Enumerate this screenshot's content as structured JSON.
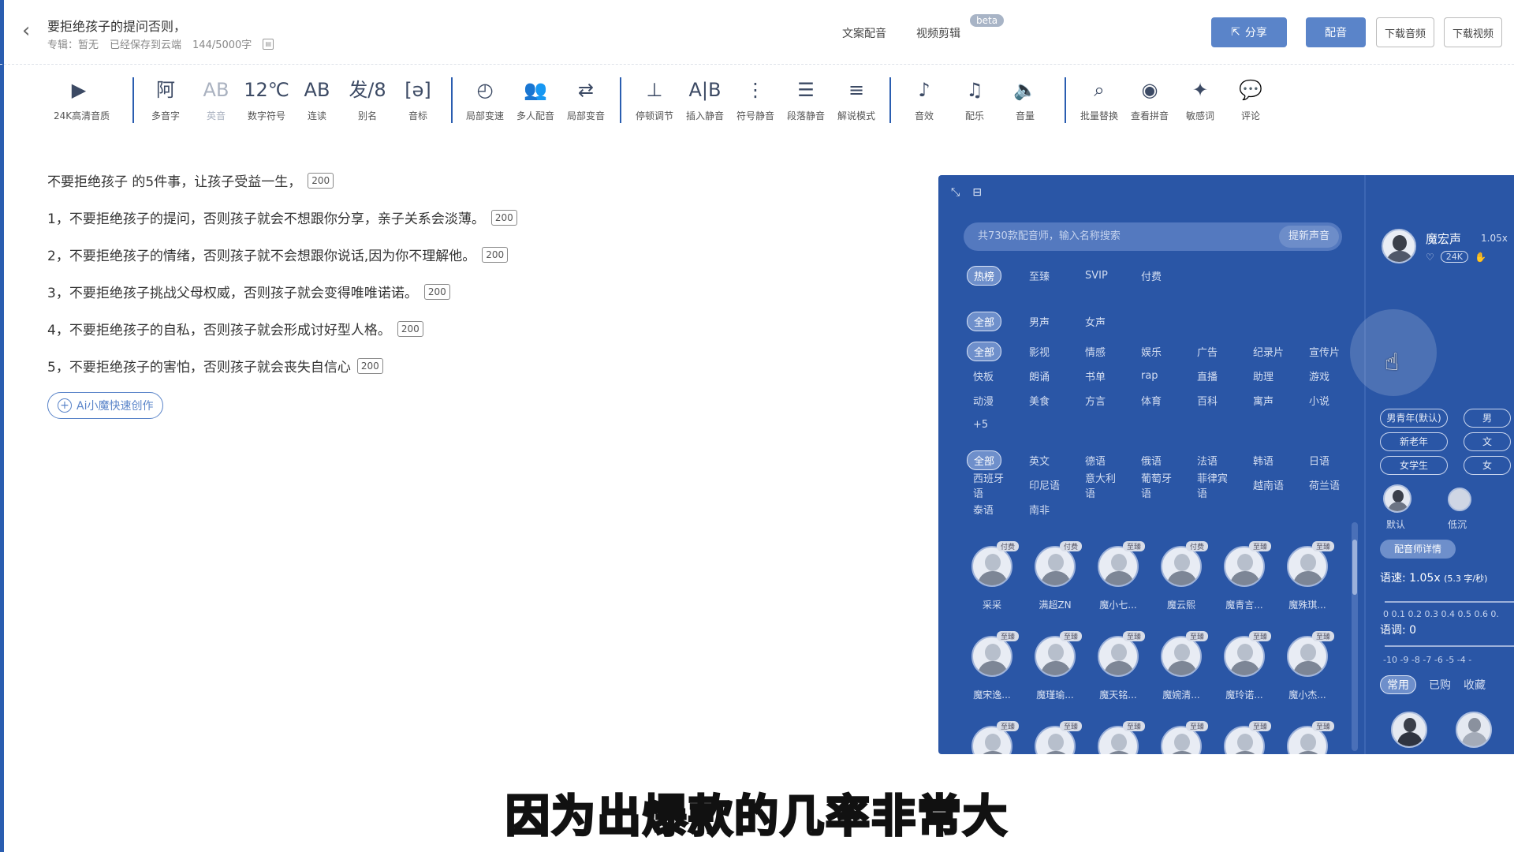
{
  "header": {
    "title": "要拒绝孩子的提问否则，",
    "album": "专辑：暂无",
    "save_status": "已经保存到云端",
    "word_count": "144/5000字",
    "links": [
      "文案配音",
      "视频剪辑"
    ],
    "beta_label": "beta",
    "share_label": "分享",
    "dub_label": "配音",
    "download_audio_label": "下载音频",
    "download_video_label": "下载视频"
  },
  "toolbar": {
    "items": [
      {
        "icon": "play-icon",
        "glyph": "▶",
        "label": "24K高清音质"
      },
      {
        "icon": "polyphone-icon",
        "glyph": "阿",
        "label": "多音字"
      },
      {
        "icon": "english-icon",
        "glyph": "AB",
        "label": "英音",
        "dim": true
      },
      {
        "icon": "number-icon",
        "glyph": "12℃",
        "label": "数字符号"
      },
      {
        "icon": "continuous-read-icon",
        "glyph": "AB",
        "label": "连读"
      },
      {
        "icon": "alias-icon",
        "glyph": "发/8",
        "label": "别名"
      },
      {
        "icon": "phonetic-icon",
        "glyph": "[ə]",
        "label": "音标"
      },
      {
        "icon": "speed-icon",
        "glyph": "◴",
        "label": "局部变速"
      },
      {
        "icon": "multi-voice-icon",
        "glyph": "👥",
        "label": "多人配音"
      },
      {
        "icon": "voice-change-icon",
        "glyph": "⇄",
        "label": "局部变音"
      },
      {
        "icon": "pause-icon",
        "glyph": "⊥",
        "label": "停顿调节"
      },
      {
        "icon": "insert-silence-icon",
        "glyph": "A|B",
        "label": "插入静音"
      },
      {
        "icon": "symbol-silence-icon",
        "glyph": "⋮",
        "label": "符号静音"
      },
      {
        "icon": "paragraph-silence-icon",
        "glyph": "☰",
        "label": "段落静音"
      },
      {
        "icon": "narration-icon",
        "glyph": "≡",
        "label": "解说模式"
      },
      {
        "icon": "sound-effect-icon",
        "glyph": "♪",
        "label": "音效"
      },
      {
        "icon": "music-icon",
        "glyph": "♫",
        "label": "配乐"
      },
      {
        "icon": "volume-icon",
        "glyph": "🔈",
        "label": "音量"
      },
      {
        "icon": "batch-replace-icon",
        "glyph": "⌕",
        "label": "批量替换"
      },
      {
        "icon": "view-pinyin-icon",
        "glyph": "◉",
        "label": "查看拼音"
      },
      {
        "icon": "sensitive-word-icon",
        "glyph": "✦",
        "label": "敏感词"
      },
      {
        "icon": "comment-icon",
        "glyph": "💬",
        "label": "评论"
      }
    ]
  },
  "content": {
    "lines": [
      {
        "text": "不要拒绝孩子 的5件事，让孩子受益一生，",
        "count": "200"
      },
      {
        "text": "1，不要拒绝孩子的提问，否则孩子就会不想跟你分享，亲子关系会淡薄。",
        "count": "200"
      },
      {
        "text": "2，不要拒绝孩子的情绪，否则孩子就不会想跟你说话,因为你不理解他。",
        "count": "200"
      },
      {
        "text": "3，不要拒绝孩子挑战父母权威，否则孩子就会变得唯唯诺诺。",
        "count": "200"
      },
      {
        "text": "4，不要拒绝孩子的自私，否则孩子就会形成讨好型人格。",
        "count": "200"
      },
      {
        "text": "5，不要拒绝孩子的害怕，否则孩子就会丧失自信心",
        "count": "200"
      }
    ],
    "ai_button": "Ai小魔快速创作"
  },
  "panel": {
    "search_placeholder": "共730款配音师，输入名称搜索",
    "search_button": "提新声音",
    "tier_tabs": [
      "热榜",
      "至臻",
      "SVIP",
      "付费"
    ],
    "gender_tabs": [
      "全部",
      "男声",
      "女声"
    ],
    "category_tabs": [
      "全部",
      "影视",
      "情感",
      "娱乐",
      "广告",
      "纪录片",
      "宣传片",
      "快板",
      "朗诵",
      "书单",
      "rap",
      "直播",
      "助理",
      "游戏",
      "动漫",
      "美食",
      "方言",
      "体育",
      "百科",
      "寓声",
      "小说",
      "+5"
    ],
    "language_tabs": [
      "全部",
      "英文",
      "德语",
      "俄语",
      "法语",
      "韩语",
      "日语",
      "西班牙语",
      "印尼语",
      "意大利语",
      "葡萄牙语",
      "菲律宾语",
      "越南语",
      "荷兰语",
      "泰语",
      "南非"
    ],
    "voices": [
      {
        "name": "采采",
        "tag": "付费"
      },
      {
        "name": "满超ZN",
        "tag": "付费"
      },
      {
        "name": "魔小七...",
        "tag": "至臻"
      },
      {
        "name": "魔云熙",
        "tag": "付费"
      },
      {
        "name": "魔青言...",
        "tag": "至臻"
      },
      {
        "name": "魔殊琪...",
        "tag": "至臻"
      },
      {
        "name": "魔宋逸...",
        "tag": "至臻"
      },
      {
        "name": "魔瑾瑜...",
        "tag": "至臻"
      },
      {
        "name": "魔天铭...",
        "tag": "至臻"
      },
      {
        "name": "魔婉清...",
        "tag": "至臻"
      },
      {
        "name": "魔玲诺...",
        "tag": "至臻"
      },
      {
        "name": "魔小杰...",
        "tag": "至臻"
      },
      {
        "name": "",
        "tag": "至臻"
      },
      {
        "name": "",
        "tag": "至臻"
      },
      {
        "name": "",
        "tag": "至臻"
      },
      {
        "name": "",
        "tag": "至臻"
      },
      {
        "name": "",
        "tag": "至臻"
      },
      {
        "name": "",
        "tag": "至臻"
      }
    ],
    "right": {
      "voice_name": "魔宏声",
      "voice_speed": "1.05x",
      "quality_badge": "24K",
      "styles": [
        "男青年(默认)",
        "男",
        "新老年",
        "文",
        "女学生",
        "女"
      ],
      "emotions": [
        "默认",
        "低沉"
      ],
      "detail_button": "配音师详情",
      "speed_label": "语速:",
      "speed_value": "1.05x",
      "speed_unit": "(5.3 字/秒)",
      "speed_ticks": "0   0.1 0.2 0.3 0.4 0.5 0.6 0.",
      "tone_label": "语调:",
      "tone_value": "0",
      "tone_ticks": "-10 -9  -8  -7  -6  -5  -4  -",
      "tabs": [
        "常用",
        "已购",
        "收藏"
      ]
    }
  },
  "subtitle": "因为出爆款的几率非常大",
  "colors": {
    "panel_bg": "#2a56a6",
    "accent": "#5a84c9"
  }
}
